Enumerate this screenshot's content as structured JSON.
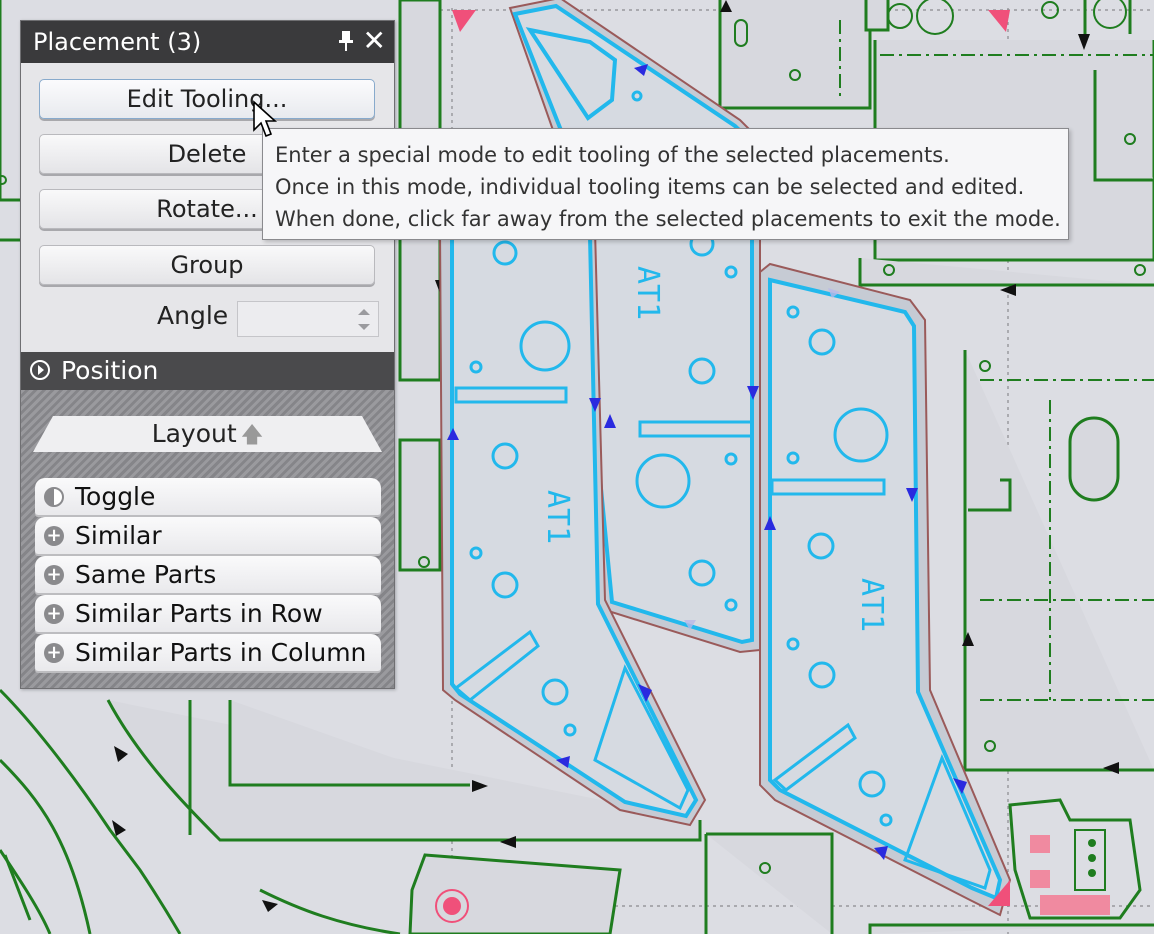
{
  "panel": {
    "title": "Placement (3)",
    "buttons": {
      "edit_tooling": "Edit Tooling...",
      "delete": "Delete",
      "rotate": "Rotate...",
      "group": "Group"
    },
    "angle_label": "Angle",
    "angle_value": "",
    "position_label": "Position",
    "layout_label": "Layout",
    "layout_items": [
      {
        "label": "Toggle",
        "icon": "half-circle-icon"
      },
      {
        "label": "Similar",
        "icon": "plus-icon"
      },
      {
        "label": "Same Parts",
        "icon": "plus-icon"
      },
      {
        "label": "Similar Parts in Row",
        "icon": "plus-icon"
      },
      {
        "label": "Similar Parts in Column",
        "icon": "plus-icon"
      }
    ]
  },
  "tooltip": {
    "lines": [
      "Enter a special mode to edit tooling of the selected placements.",
      "Once in this mode, individual tooling items can be selected and edited.",
      "When done, click far away from the selected placements to exit the mode."
    ]
  },
  "parts": {
    "label": "AT1"
  },
  "colors": {
    "part_outline": "#1f7d1f",
    "selected_part": "#22b8ec",
    "offset_outline": "#9a5a5a",
    "marker": "#2a2adf",
    "origin_marker": "#f0507a"
  }
}
